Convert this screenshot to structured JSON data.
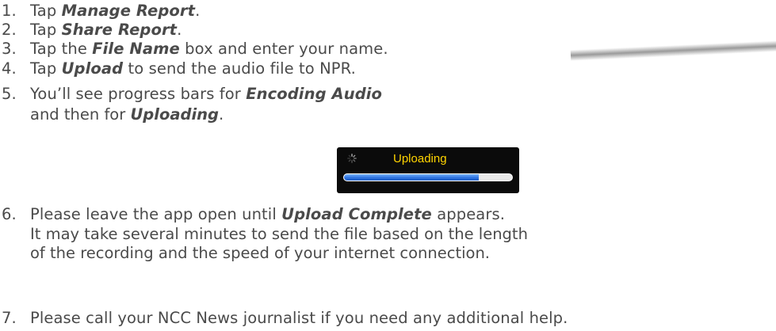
{
  "steps": [
    {
      "num": "1.",
      "pre": "Tap ",
      "em": "Manage Report",
      "post": "."
    },
    {
      "num": "2.",
      "pre": "Tap ",
      "em": "Share Report",
      "post": "."
    },
    {
      "num": "3.",
      "pre": "Tap the ",
      "em": "File Name",
      "post": " box and enter your name."
    },
    {
      "num": "4.",
      "pre": "Tap ",
      "em": "Upload",
      "post": " to send the audio file to NPR."
    },
    {
      "num": "5.",
      "pre": "You’ll see progress bars for ",
      "em": "Encoding Audio",
      "post": "",
      "line2_pre": "and then for ",
      "line2_em": "Uploading",
      "line2_post": "."
    },
    {
      "num": "6.",
      "pre": "Please leave the app open until ",
      "em": "Upload Complete",
      "post": " appears.",
      "line2": "It may take several minutes to send the file based on the length",
      "line3": "of the recording and the speed of your internet connection."
    },
    {
      "num": "7.",
      "pre": "Please call your NCC News journalist if you need any additional help.",
      "em": "",
      "post": ""
    }
  ],
  "upload_widget": {
    "label": "Uploading",
    "progress": 0.8,
    "label_color": "#ffd400",
    "bar_color": "#2d73e0",
    "spinner_icon": "activity-spinner-icon"
  }
}
